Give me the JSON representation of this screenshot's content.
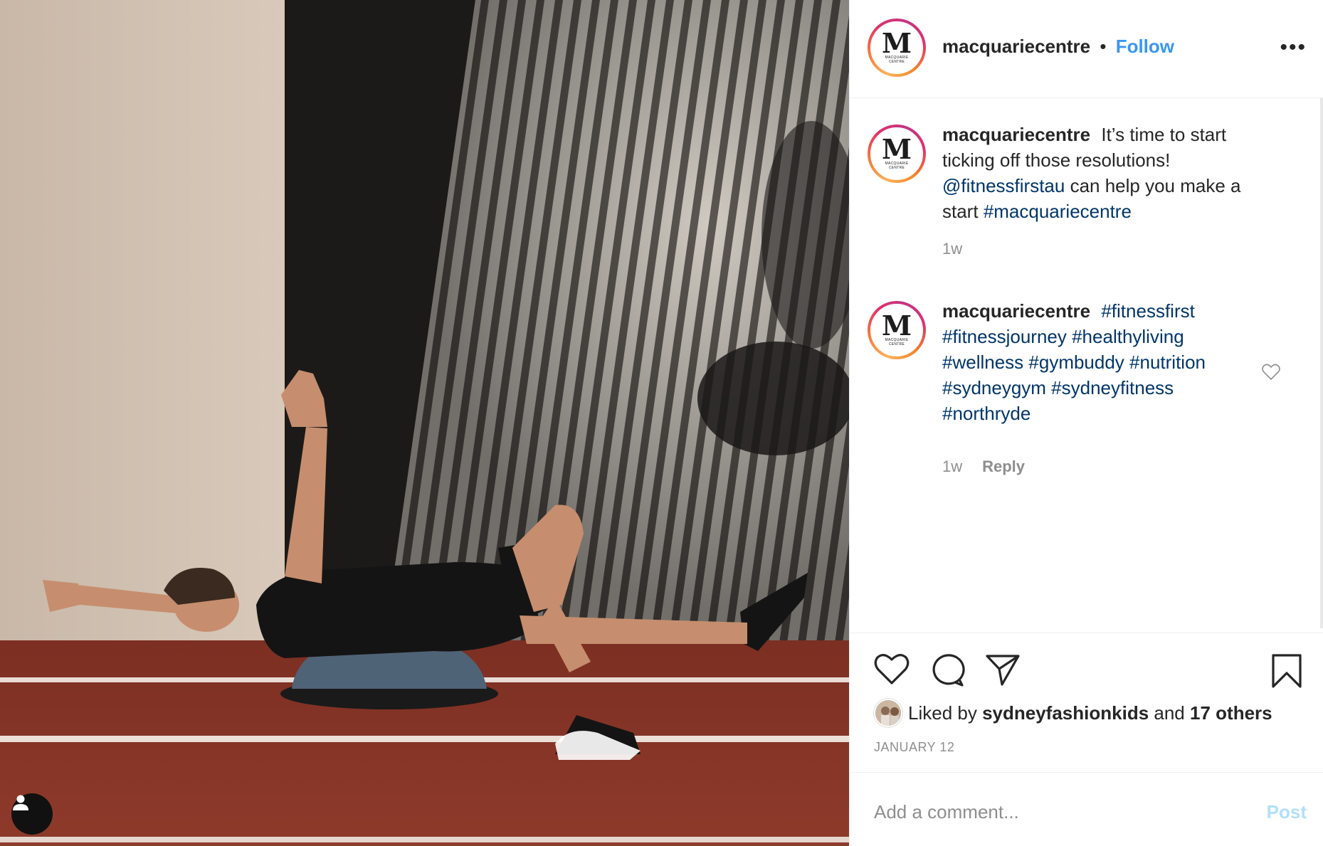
{
  "post": {
    "username": "macquariecentre",
    "separator": "•",
    "follow_label": "Follow",
    "more_icon": "•••",
    "avatar": {
      "letter": "M",
      "sub1": "MACQUARIE",
      "sub2": "CENTRE"
    }
  },
  "caption": {
    "username": "macquariecentre",
    "text1": "It’s time to start ticking off those resolutions!",
    "mention": "@fitnessfirstau",
    "text2": "can help you make a start",
    "hashtag": "#macquariecentre",
    "time": "1w"
  },
  "comment": {
    "username": "macquariecentre",
    "hashtags": "#fitnessfirst #fitnessjourney #healthyliving #wellness #gymbuddy #nutrition #sydneygym #sydneyfitness #northryde",
    "time": "1w",
    "reply_label": "Reply"
  },
  "likes": {
    "prefix": "Liked by",
    "user": "sydneyfashionkids",
    "middle": "and",
    "others": "17 others"
  },
  "date": "JANUARY 12",
  "add_comment": {
    "placeholder": "Add a comment...",
    "post_label": "Post"
  },
  "colors": {
    "link_blue": "#3897f0",
    "hashtag_navy": "#003569",
    "muted": "#8e8e8e"
  }
}
